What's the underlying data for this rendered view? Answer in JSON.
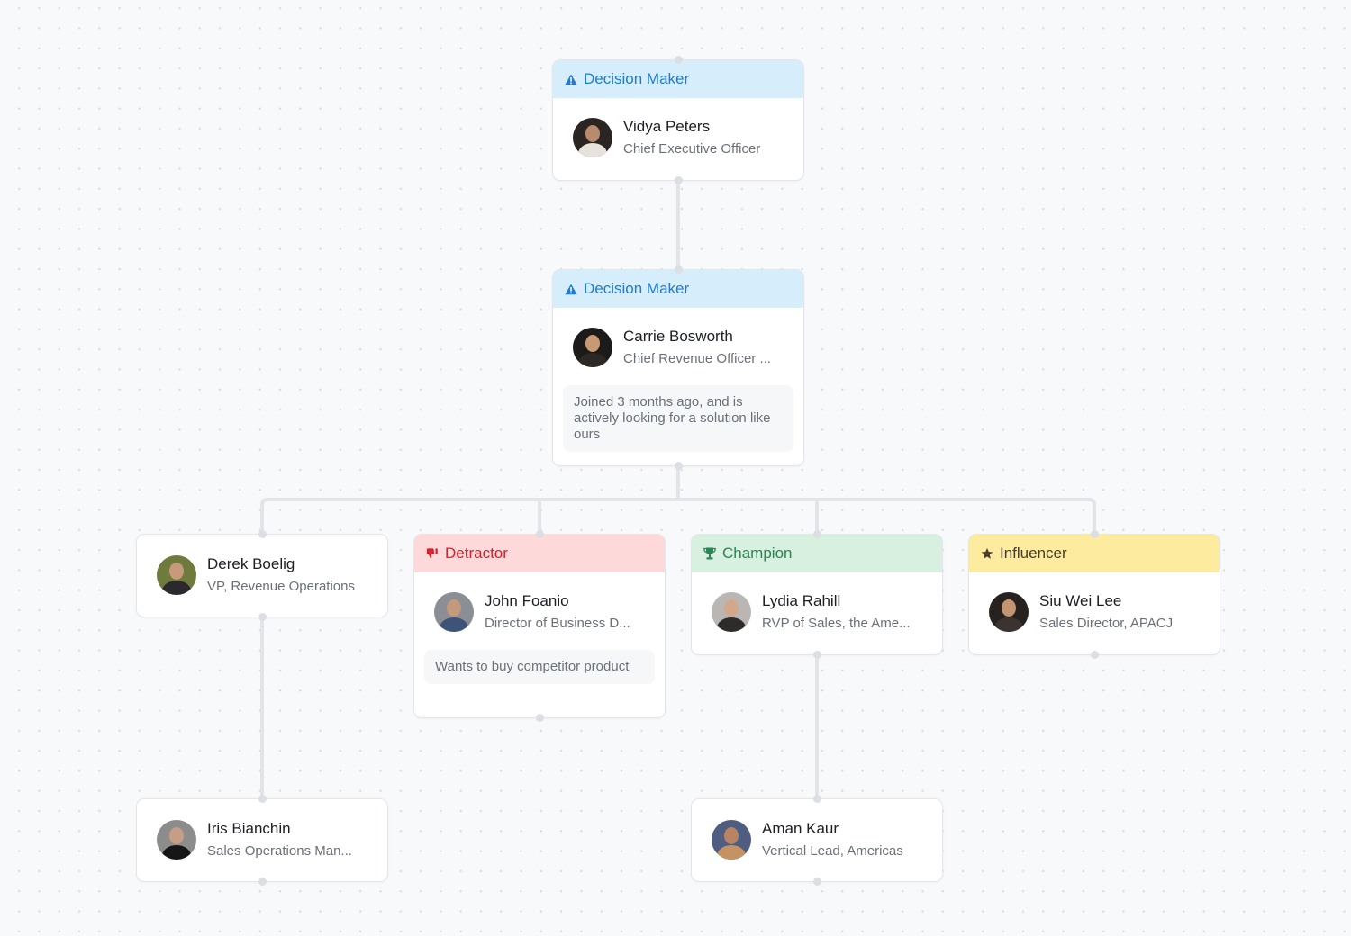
{
  "roles": {
    "decision_maker": {
      "label": "Decision Maker",
      "icon": "warning-icon",
      "bg": "#d6eefc",
      "fg": "#1f7ad8"
    },
    "detractor": {
      "label": "Detractor",
      "icon": "thumbs-down-icon",
      "bg": "#fdd9d9",
      "fg": "#d81f2c"
    },
    "champion": {
      "label": "Champion",
      "icon": "trophy-icon",
      "bg": "#d7f0e0",
      "fg": "#2b8453"
    },
    "influencer": {
      "label": "Influencer",
      "icon": "star-icon",
      "bg": "#fdeba0",
      "fg": "#4a3a2c"
    }
  },
  "nodes": [
    {
      "id": "vidya",
      "name": "Vidya Peters",
      "title": "Chief Executive Officer",
      "role": "decision_maker",
      "header": "Decision Maker"
    },
    {
      "id": "carrie",
      "name": "Carrie Bosworth",
      "title": "Chief Revenue Officer ...",
      "role": "decision_maker",
      "header": "Decision Maker",
      "note": "Joined 3 months ago, and is actively looking for a solution like ours"
    },
    {
      "id": "derek",
      "name": "Derek Boelig",
      "title": "VP, Revenue Operations"
    },
    {
      "id": "john",
      "name": "John Foanio",
      "title": "Director of Business D...",
      "role": "detractor",
      "header": "Detractor",
      "note": "Wants to buy competitor product"
    },
    {
      "id": "lydia",
      "name": "Lydia Rahill",
      "title": "RVP of Sales, the Ame...",
      "role": "champion",
      "header": "Champion"
    },
    {
      "id": "siu",
      "name": "Siu Wei Lee",
      "title": "Sales Director, APACJ",
      "role": "influencer",
      "header": "Influencer"
    },
    {
      "id": "iris",
      "name": "Iris Bianchin",
      "title": "Sales Operations Man..."
    },
    {
      "id": "aman",
      "name": "Aman Kaur",
      "title": "Vertical Lead, Americas"
    }
  ],
  "edges": [
    [
      "vidya",
      "carrie"
    ],
    [
      "carrie",
      "derek"
    ],
    [
      "carrie",
      "john"
    ],
    [
      "carrie",
      "lydia"
    ],
    [
      "carrie",
      "siu"
    ],
    [
      "derek",
      "iris"
    ],
    [
      "lydia",
      "aman"
    ]
  ],
  "colors": {
    "connector": "#e2e4e8",
    "port": "#dcdee3"
  }
}
